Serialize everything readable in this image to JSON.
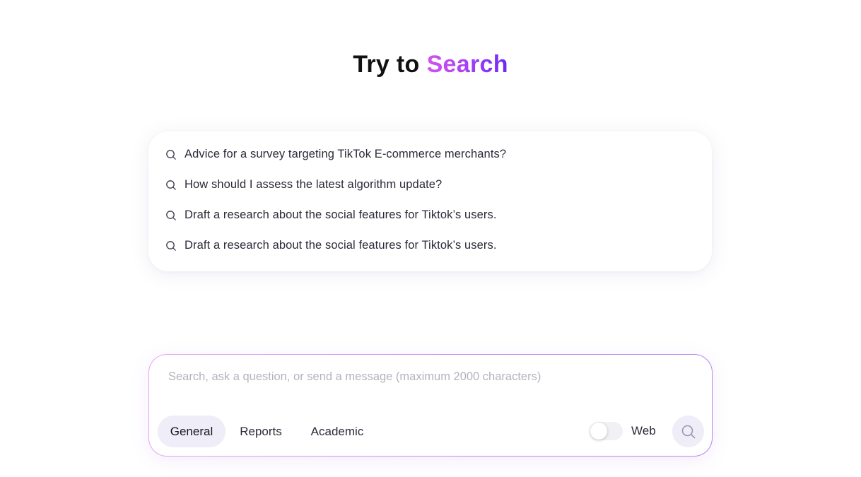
{
  "title": {
    "prefix": "Try to",
    "accent": "Search"
  },
  "suggestions": [
    {
      "icon": "search-icon",
      "text": "Advice for a survey targeting TikTok E-commerce merchants?"
    },
    {
      "icon": "search-icon",
      "text": "How should I assess the latest algorithm update?"
    },
    {
      "icon": "search-icon",
      "text": "Draft a research about the social features for Tiktok’s users."
    },
    {
      "icon": "search-icon",
      "text": "Draft a research about the social features for Tiktok’s users."
    }
  ],
  "composer": {
    "value": "",
    "placeholder": "Search, ask a question, or send a message (maximum 2000 characters)",
    "modes": [
      {
        "label": "General",
        "active": true
      },
      {
        "label": "Reports",
        "active": false
      },
      {
        "label": "Academic",
        "active": false
      }
    ],
    "web_toggle": {
      "label": "Web",
      "enabled": false
    },
    "send_icon": "search-icon"
  },
  "colors": {
    "accent_start": "#d452f0",
    "accent_end": "#6a2bf2",
    "active_mode_bg": "#efeef8",
    "text": "#2b2b3a",
    "placeholder": "#b3b3be"
  }
}
